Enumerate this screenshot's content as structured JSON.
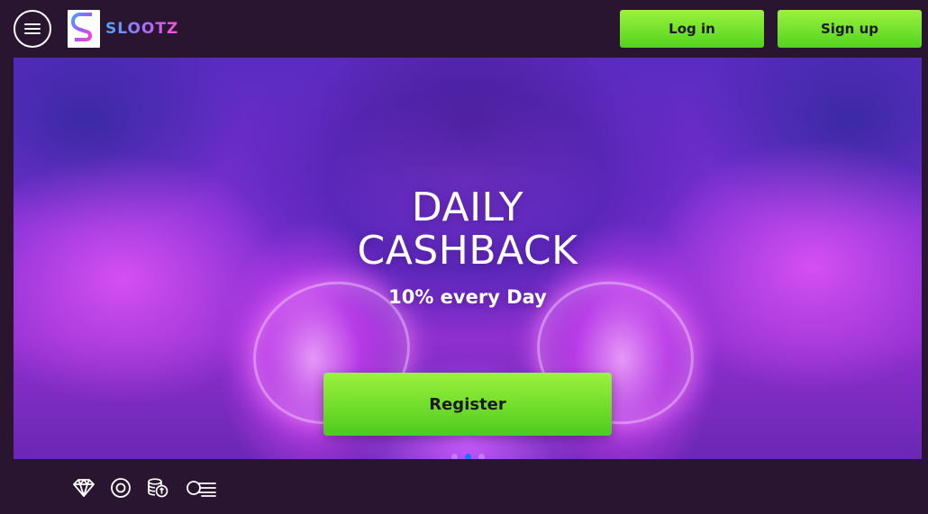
{
  "header": {
    "menu_icon": "hamburger-menu-icon",
    "logo": {
      "text": "SLOOTZ",
      "colors": [
        "#46a8ff",
        "#a96bff",
        "#ff4fd8"
      ]
    },
    "login_label": "Log in",
    "signup_label": "Sign up"
  },
  "hero": {
    "title_line1": "DAILY",
    "title_line2": "CASHBACK",
    "subtitle": "10% every Day",
    "cta_label": "Register",
    "slides": 3,
    "active_slide": 2
  },
  "categories": {
    "icons": [
      "diamond-icon",
      "target-icon",
      "coin-stack-icon",
      "list-icon"
    ]
  },
  "colors": {
    "background": "#2a1530",
    "accent_green": "#6ee02a",
    "button_text": "#1d1a1f",
    "active_dot": "#1a74ff"
  }
}
